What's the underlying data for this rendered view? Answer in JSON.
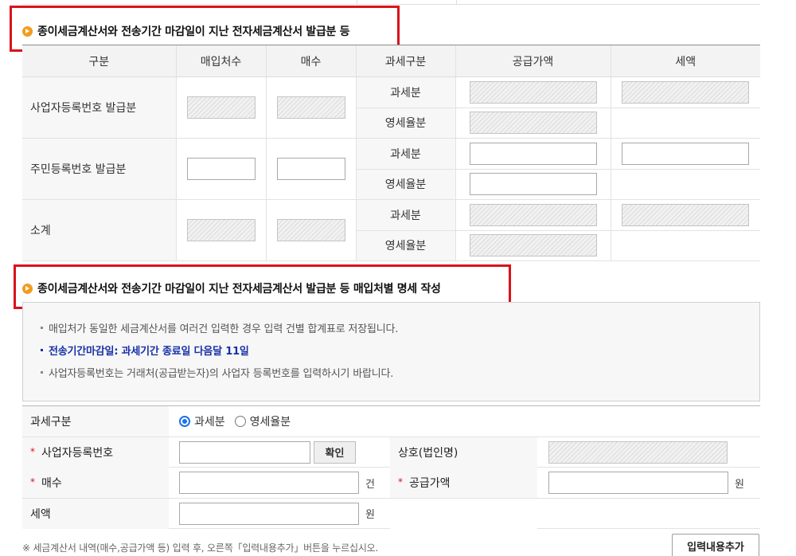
{
  "section1": {
    "title": "종이세금계산서와 전송기간 마감일이 지난 전자세금계산서 발급분 등"
  },
  "summary_table": {
    "headers": [
      "구분",
      "매입처수",
      "매수",
      "과세구분",
      "공급가액",
      "세액"
    ],
    "rows": [
      {
        "label": "사업자등록번호 발급분",
        "tax_types": [
          "과세분",
          "영세율분"
        ]
      },
      {
        "label": "주민등록번호 발급분",
        "tax_types": [
          "과세분",
          "영세율분"
        ]
      },
      {
        "label": "소계",
        "tax_types": [
          "과세분",
          "영세율분"
        ]
      }
    ]
  },
  "section2": {
    "title": "종이세금계산서와 전송기간 마감일이 지난 전자세금계산서 발급분 등 매입처별 명세 작성"
  },
  "notice": {
    "lines": [
      "매입처가 동일한 세금계산서를 여러건 입력한 경우 입력 건별 합계표로 저장됩니다.",
      "전송기간마감일: 과세기간 종료일 다음달 11일",
      "사업자등록번호는 거래처(공급받는자)의 사업자 등록번호를 입력하시기 바랍니다."
    ]
  },
  "form": {
    "tax_category_label": "과세구분",
    "radio_taxable": "과세분",
    "radio_zero_rate": "영세율분",
    "selected": "과세분",
    "biz_no_label": "사업자등록번호",
    "confirm_button": "확인",
    "company_label": "상호(법인명)",
    "count_label": "매수",
    "count_unit": "건",
    "supply_label": "공급가액",
    "supply_unit": "원",
    "tax_label": "세액",
    "tax_unit": "원",
    "required_mark": "*"
  },
  "footnote": "※ 세금계산서 내역(매수,공급가액 등) 입력 후, 오른쪽「입력내용추가」버튼을 누르십시오.",
  "add_button": "입력내용추가",
  "colors": {
    "highlight_border": "#d9121b",
    "accent_blue": "#1730a8",
    "bullet": "#f29c1f"
  }
}
